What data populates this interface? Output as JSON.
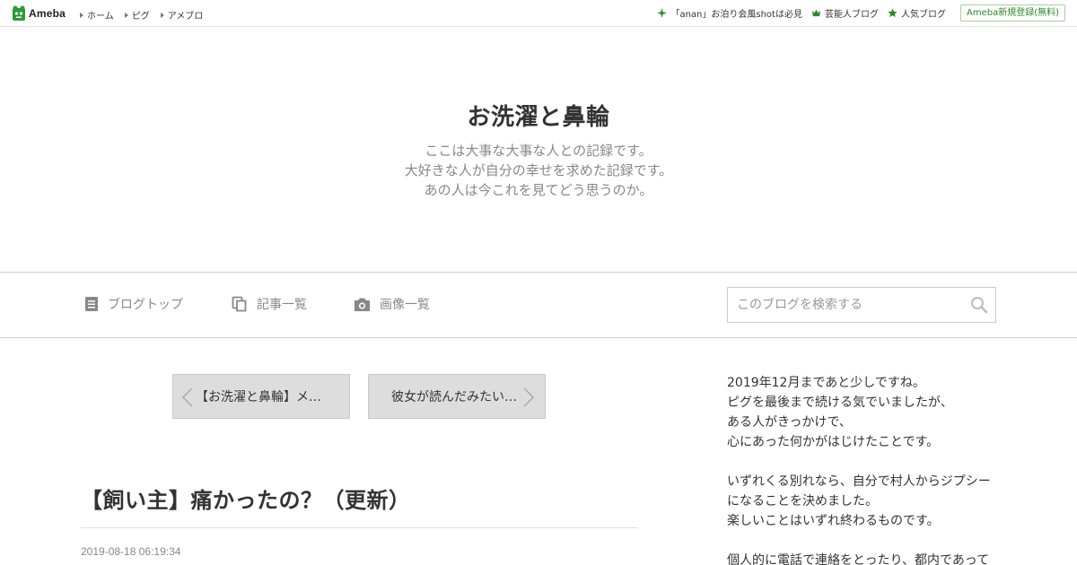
{
  "topbar": {
    "logo_text": "Ameba",
    "nav": [
      "ホーム",
      "ピグ",
      "アメブロ"
    ],
    "links": [
      {
        "label": "「anan」お泊り会風shotは必見",
        "icon": "sparkle-icon"
      },
      {
        "label": "芸能人ブログ",
        "icon": "crown-icon"
      },
      {
        "label": "人気ブログ",
        "icon": "star-icon"
      }
    ],
    "register_label": "Ameba新規登録(無料)",
    "accent_color": "#2c8a2c"
  },
  "header": {
    "title": "お洗濯と鼻輪",
    "description": [
      "ここは大事な大事な人との記録です。",
      "大好きな人が自分の幸せを求めた記録です。",
      "あの人は今これを見てどう思うのか。"
    ]
  },
  "nav": {
    "items": [
      {
        "label": "ブログトップ",
        "icon": "document-icon"
      },
      {
        "label": "記事一覧",
        "icon": "pages-icon"
      },
      {
        "label": "画像一覧",
        "icon": "camera-icon"
      }
    ],
    "search_placeholder": "このブログを検索する"
  },
  "pager": {
    "prev_label": "【お洗濯と鼻輪】メ…",
    "next_label": "彼女が読んだみたい…"
  },
  "entry": {
    "title": "【飼い主】痛かったの？（更新）",
    "date": "2019-08-18 06:19:34"
  },
  "sidebar": {
    "paragraphs": [
      [
        "2019年12月まであと少しですね。",
        "ピグを最後まで続ける気でいましたが、",
        "ある人がきっかけで、",
        "心にあった何かがはじけたことです。"
      ],
      [
        "いずれくる別れなら、自分で村人からジプシー",
        "になることを決めました。",
        "楽しいことはいずれ終わるものです。"
      ],
      [
        "個人的に電話で連絡をとったり、都内であって"
      ]
    ]
  }
}
